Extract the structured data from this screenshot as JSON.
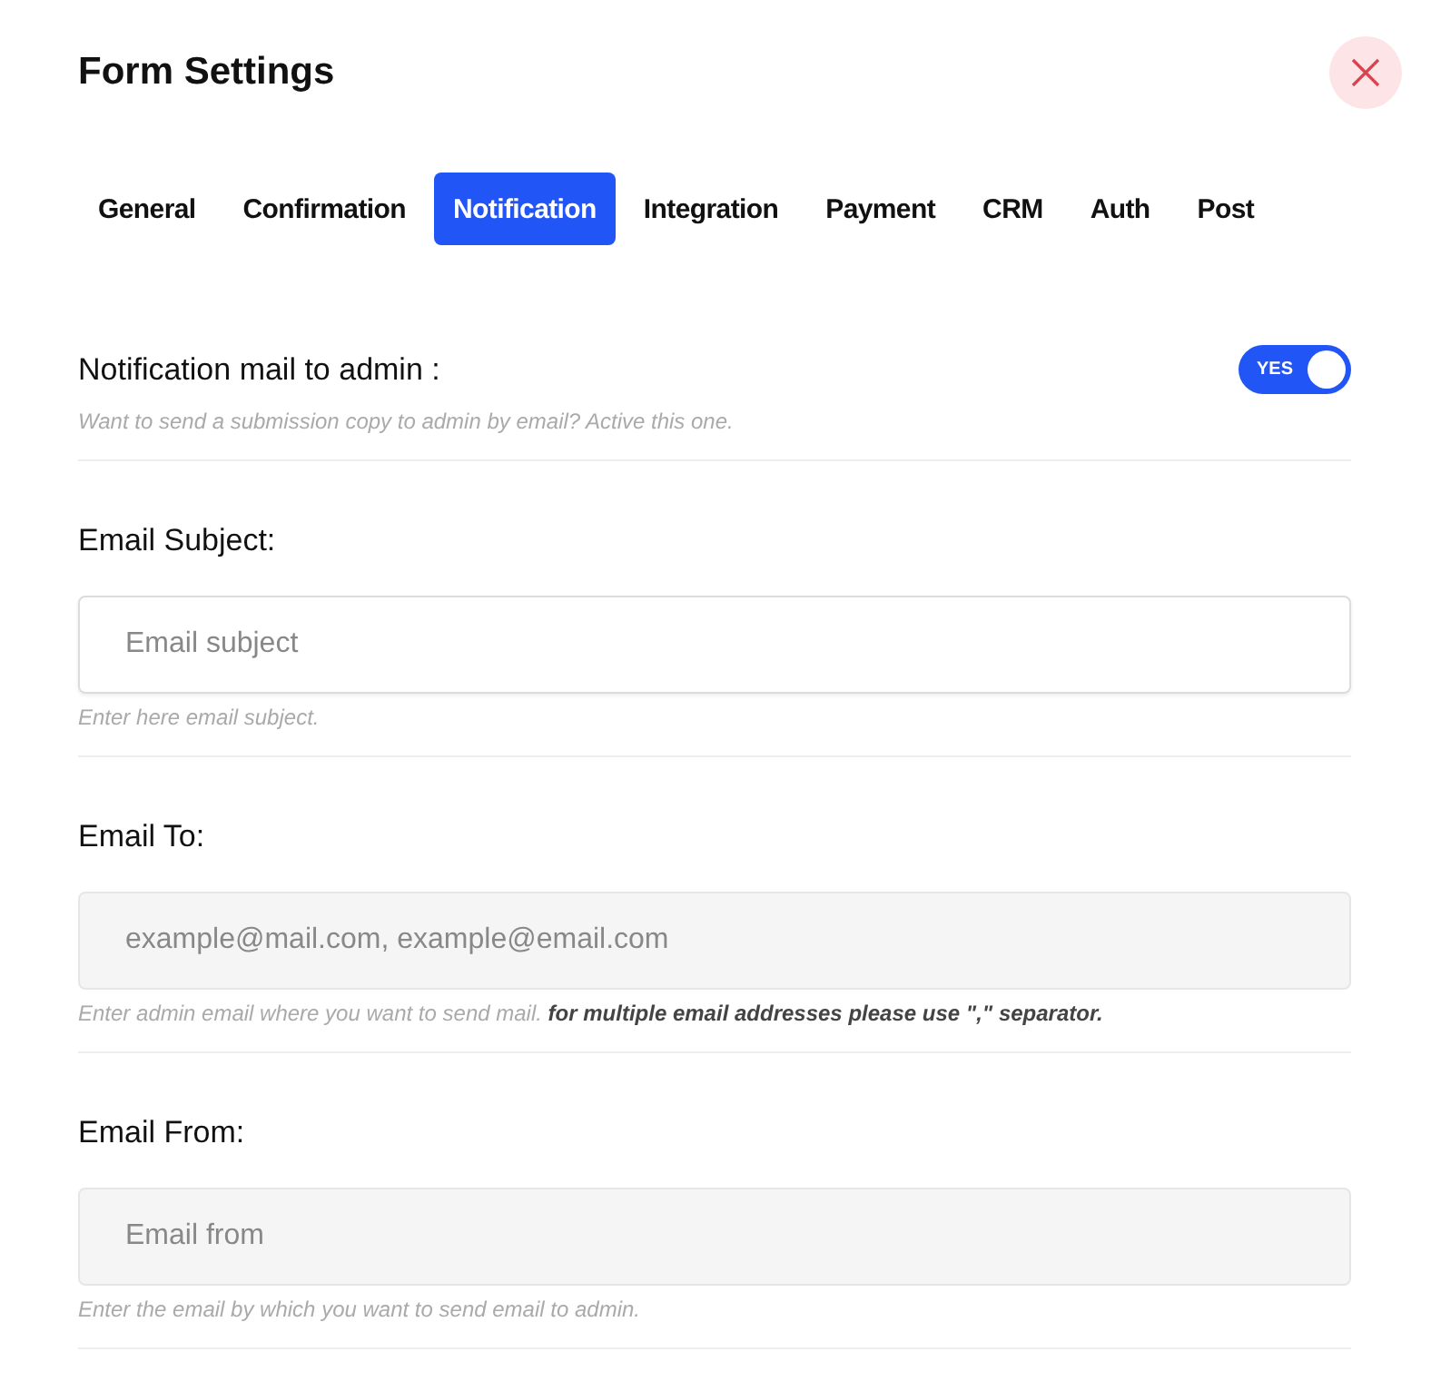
{
  "window": {
    "title": "Form Settings"
  },
  "tabs": [
    {
      "label": "General",
      "selected": false
    },
    {
      "label": "Confirmation",
      "selected": false
    },
    {
      "label": "Notification",
      "selected": true
    },
    {
      "label": "Integration",
      "selected": false
    },
    {
      "label": "Payment",
      "selected": false
    },
    {
      "label": "CRM",
      "selected": false
    },
    {
      "label": "Auth",
      "selected": false
    },
    {
      "label": "Post",
      "selected": false
    }
  ],
  "sections": [
    {
      "kind": "toggle",
      "label": "Notification mail to admin :",
      "on": true,
      "toggle_text": "YES",
      "help": "Want to send a submission copy to admin by email? Active this one."
    },
    {
      "kind": "field",
      "label": "Email Subject:",
      "placeholder": "Email subject",
      "active": true,
      "help": "Enter here email subject."
    },
    {
      "kind": "field",
      "label": "Email To:",
      "placeholder": "example@mail.com, example@email.com",
      "active": false,
      "help": "Enter admin email where you want to send mail. **for multiple email addresses please use \",\" separator.**"
    },
    {
      "kind": "field",
      "label": "Email From:",
      "placeholder": "Email from",
      "active": false,
      "help": "Enter the email by which you want to send email to admin."
    }
  ]
}
